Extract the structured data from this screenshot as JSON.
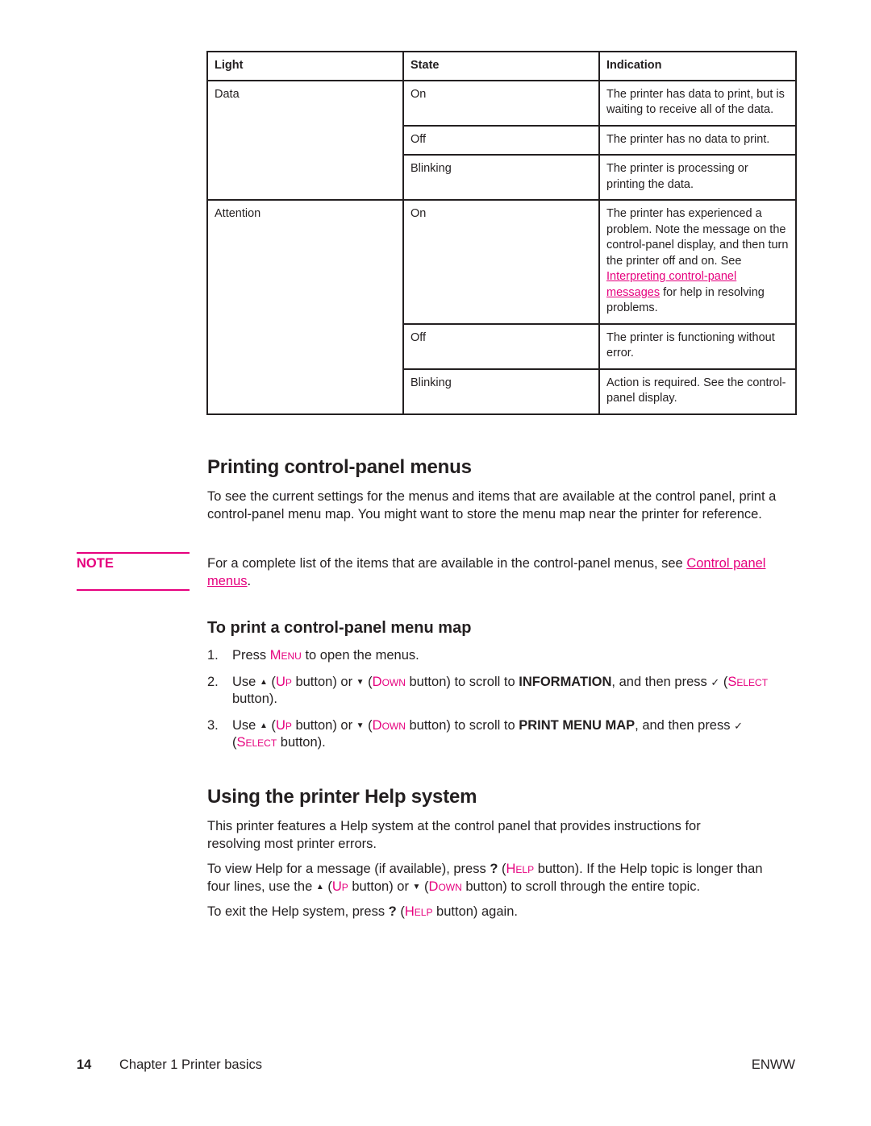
{
  "table": {
    "headers": [
      "Light",
      "State",
      "Indication"
    ],
    "groups": [
      {
        "light": "Data",
        "rows": [
          {
            "state": "On",
            "indication": "The printer has data to print, but is waiting to receive all of the data."
          },
          {
            "state": "Off",
            "indication": "The printer has no data to print."
          },
          {
            "state": "Blinking",
            "indication": "The printer is processing or printing the data."
          }
        ]
      },
      {
        "light": "Attention",
        "rows": [
          {
            "state": "On",
            "indication_pre": "The printer has experienced a problem. Note the message on the control-panel display, and then turn the printer off and on. See ",
            "indication_link": "Interpreting control-panel messages",
            "indication_post": " for help in resolving problems."
          },
          {
            "state": "Off",
            "indication": "The printer is functioning without error."
          },
          {
            "state": "Blinking",
            "indication": "Action is required. See the control-panel display."
          }
        ]
      }
    ]
  },
  "section1": {
    "title": "Printing control-panel menus",
    "intro": "To see the current settings for the menus and items that are available at the control panel, print a control-panel menu map. You might want to store the menu map near the printer for reference.",
    "note": {
      "label": "NOTE",
      "text_pre": "For a complete list of the items that are available in the control-panel menus, see ",
      "link": "Control panel menus",
      "text_post": "."
    },
    "subtitle": "To print a control-panel menu map",
    "steps": [
      {
        "num": "1.",
        "pre": "Press ",
        "key": "Menu",
        "post": " to open the menus."
      },
      {
        "num": "2.",
        "use": "Use ",
        "up_key": "Up",
        "mid1": " button) or ",
        "down_key": "Down",
        "mid2": " button) to scroll to ",
        "bold": "INFORMATION",
        "after_bold": ", and then press ",
        "select_key": "Select",
        "end": " button)."
      },
      {
        "num": "3.",
        "use": "Use ",
        "up_key": "Up",
        "mid1": " button) or ",
        "down_key": "Down",
        "mid2": " button) to scroll to ",
        "bold": "PRINT MENU MAP",
        "after_bold": ", and then press ",
        "select_key": "Select",
        "end": " button)."
      }
    ]
  },
  "section2": {
    "title": "Using the printer Help system",
    "p1": "This printer features a Help system at the control panel that provides instructions for resolving most printer errors.",
    "p2": {
      "a": "To view Help for a message (if available), press ",
      "q": "?",
      "help_key": "Help",
      "b": " button). If the Help topic is longer than four lines, use the ",
      "up_key": "Up",
      "c": " button) or ",
      "down_key": "Down",
      "d": " button) to scroll through the entire topic."
    },
    "p3": {
      "a": "To exit the Help system, press ",
      "q": "?",
      "help_key": "Help",
      "b": " button) again."
    }
  },
  "icons": {
    "up": "▲",
    "down": "▼",
    "check": "✓"
  },
  "footer": {
    "page_number": "14",
    "chapter": "Chapter 1  Printer basics",
    "doc_code": "ENWW"
  },
  "colors": {
    "accent": "#e6007e",
    "text": "#231f20"
  }
}
